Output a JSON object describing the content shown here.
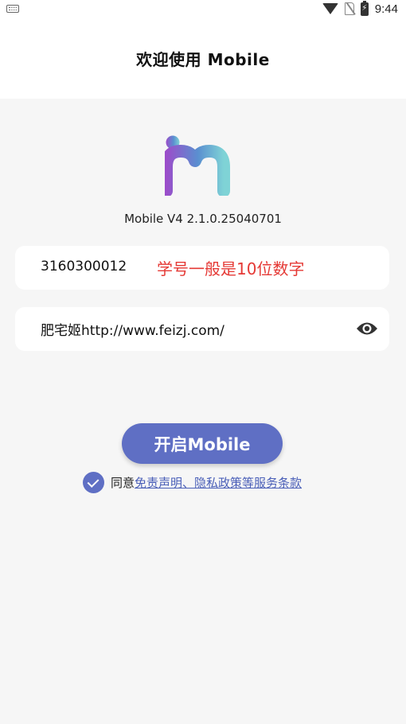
{
  "status_bar": {
    "time": "9:44",
    "icons": [
      "keyboard-icon",
      "wifi-icon",
      "no-sim-icon",
      "battery-charging-icon"
    ]
  },
  "app_bar": {
    "title": "欢迎使用 Mobile"
  },
  "logo": {
    "icon": "app-logo-im",
    "colors": [
      "#9b4dca",
      "#4ea8c9",
      "#7fd3d6"
    ]
  },
  "version": "Mobile V4 2.1.0.25040701",
  "username": {
    "value": "3160300012",
    "hint": "学号一般是10位数字",
    "hint_color": "#e53935"
  },
  "password": {
    "value": "肥宅姬http://www.feizj.com/",
    "toggle_icon": "eye-icon"
  },
  "start_button": {
    "label": "开启Mobile",
    "color": "#5f6fc4"
  },
  "agreement": {
    "checked": true,
    "prefix": "同意",
    "link_text": "免责声明、隐私政策等服务条款"
  }
}
